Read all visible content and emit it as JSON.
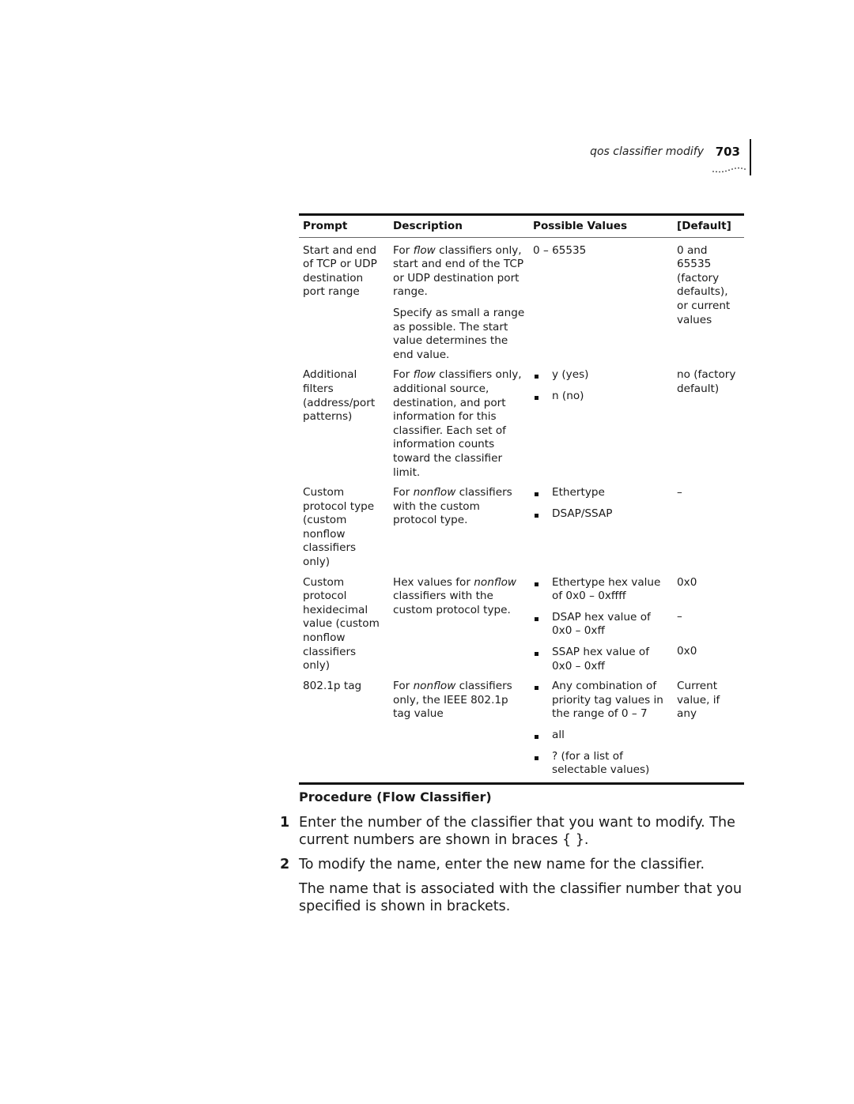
{
  "header": {
    "running_title": "qos classifier modify",
    "page_number": "703"
  },
  "table": {
    "columns": [
      "Prompt",
      "Description",
      "Possible Values",
      "[Default]"
    ],
    "rows": [
      {
        "prompt": "Start and end of TCP or UDP destination port range",
        "description": [
          {
            "pre": "For ",
            "em": "flow",
            "post": " classifiers only, start and end of the TCP or UDP destination port range."
          },
          {
            "pre": "Specify as small a range as possible. The start value determines the end value.",
            "em": "",
            "post": ""
          }
        ],
        "values_text": "0 – 65535",
        "defaults": [
          "0 and 65535 (factory defaults), or current values"
        ]
      },
      {
        "prompt": "Additional filters (address/port patterns)",
        "description": [
          {
            "pre": "For ",
            "em": "flow",
            "post": " classifiers only, additional source, destination, and port information for this classifier. Each set of information counts toward the classifier limit."
          }
        ],
        "values": [
          "y (yes)",
          "n (no)"
        ],
        "defaults": [
          "no (factory default)"
        ]
      },
      {
        "prompt": "Custom protocol type (custom nonflow classifiers only)",
        "description": [
          {
            "pre": "For ",
            "em": "nonflow",
            "post": " classifiers with the custom protocol type."
          }
        ],
        "values": [
          "Ethertype",
          "DSAP/SSAP"
        ],
        "defaults": [
          "–"
        ]
      },
      {
        "prompt": "Custom protocol hexidecimal value (custom nonflow classifiers only)",
        "description": [
          {
            "pre": "Hex values for ",
            "em": "nonflow",
            "post": " classifiers with the custom protocol type."
          }
        ],
        "values": [
          "Ethertype hex value of 0x0 – 0xffff",
          "DSAP hex value of 0x0 – 0xff",
          "SSAP hex value of 0x0 – 0xff"
        ],
        "defaults": [
          "0x0",
          "–",
          "0x0"
        ]
      },
      {
        "prompt": "802.1p tag",
        "description": [
          {
            "pre": "For ",
            "em": "nonflow",
            "post": " classifiers only, the IEEE 802.1p tag value"
          }
        ],
        "values": [
          "Any combination of priority tag values in the range of 0 – 7",
          "all",
          "? (for a list of selectable values)"
        ],
        "defaults": [
          "Current value, if any"
        ]
      }
    ]
  },
  "procedure": {
    "heading": "Procedure (Flow Classifier)",
    "steps": [
      {
        "num": "1",
        "text": "Enter the number of the classifier that you want to modify. The current numbers are shown in braces { }."
      },
      {
        "num": "2",
        "text": "To modify the name, enter the new name for the classifier."
      }
    ],
    "note": "The name that is associated with the classifier number that you specified is shown in brackets."
  }
}
